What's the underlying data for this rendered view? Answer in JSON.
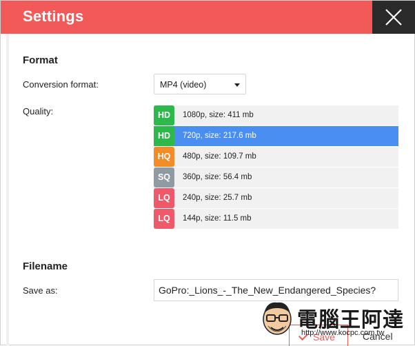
{
  "window": {
    "title": "Settings"
  },
  "format": {
    "heading": "Format",
    "conversion_label": "Conversion format:",
    "conversion_value": "MP4 (video)",
    "quality_label": "Quality:"
  },
  "quality_options": [
    {
      "badge": "HD",
      "label": "1080p, size: 411 mb",
      "color": "#2db84c",
      "selected": false
    },
    {
      "badge": "HD",
      "label": "720p, size: 217.6 mb",
      "color": "#2db84c",
      "selected": true
    },
    {
      "badge": "HQ",
      "label": "480p, size: 109.7 mb",
      "color": "#f28c28",
      "selected": false
    },
    {
      "badge": "SQ",
      "label": "360p, size: 56.4 mb",
      "color": "#8f9aa3",
      "selected": false
    },
    {
      "badge": "LQ",
      "label": "240p, size: 25.7 mb",
      "color": "#ee5a6a",
      "selected": false
    },
    {
      "badge": "LQ",
      "label": "144p, size: 11.5 mb",
      "color": "#ee5a6a",
      "selected": false
    }
  ],
  "filename": {
    "heading": "Filename",
    "save_as_label": "Save as:",
    "value": "GoPro:_Lions_-_The_New_Endangered_Species?"
  },
  "footer": {
    "save_label": "Save",
    "cancel_label": "Cancel"
  },
  "watermark": {
    "brand": "電腦王阿達",
    "url": "http://www.kocpc.com.tw"
  },
  "colors": {
    "header": "#f25a5a",
    "close_bg": "#2a2a2a",
    "selected": "#4a8ef2"
  },
  "icons": {
    "close": "close-icon",
    "dropdown": "chevron-down-icon",
    "save": "check-icon"
  }
}
